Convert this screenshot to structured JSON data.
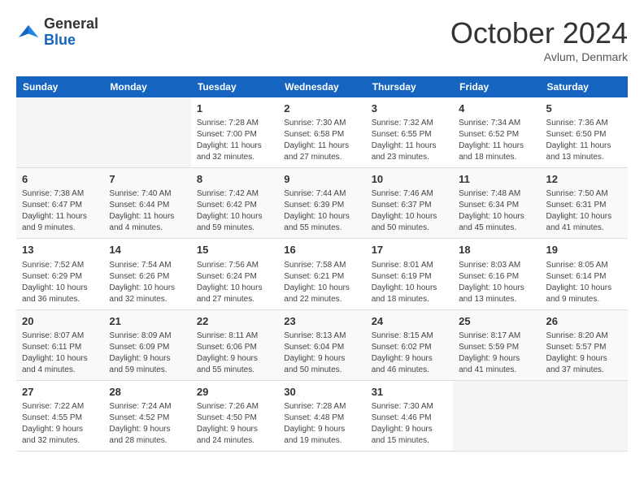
{
  "header": {
    "logo_line1": "General",
    "logo_line2": "Blue",
    "month_title": "October 2024",
    "location": "Avlum, Denmark"
  },
  "weekdays": [
    "Sunday",
    "Monday",
    "Tuesday",
    "Wednesday",
    "Thursday",
    "Friday",
    "Saturday"
  ],
  "weeks": [
    [
      {
        "day": "",
        "info": ""
      },
      {
        "day": "",
        "info": ""
      },
      {
        "day": "1",
        "info": "Sunrise: 7:28 AM\nSunset: 7:00 PM\nDaylight: 11 hours and 32 minutes."
      },
      {
        "day": "2",
        "info": "Sunrise: 7:30 AM\nSunset: 6:58 PM\nDaylight: 11 hours and 27 minutes."
      },
      {
        "day": "3",
        "info": "Sunrise: 7:32 AM\nSunset: 6:55 PM\nDaylight: 11 hours and 23 minutes."
      },
      {
        "day": "4",
        "info": "Sunrise: 7:34 AM\nSunset: 6:52 PM\nDaylight: 11 hours and 18 minutes."
      },
      {
        "day": "5",
        "info": "Sunrise: 7:36 AM\nSunset: 6:50 PM\nDaylight: 11 hours and 13 minutes."
      }
    ],
    [
      {
        "day": "6",
        "info": "Sunrise: 7:38 AM\nSunset: 6:47 PM\nDaylight: 11 hours and 9 minutes."
      },
      {
        "day": "7",
        "info": "Sunrise: 7:40 AM\nSunset: 6:44 PM\nDaylight: 11 hours and 4 minutes."
      },
      {
        "day": "8",
        "info": "Sunrise: 7:42 AM\nSunset: 6:42 PM\nDaylight: 10 hours and 59 minutes."
      },
      {
        "day": "9",
        "info": "Sunrise: 7:44 AM\nSunset: 6:39 PM\nDaylight: 10 hours and 55 minutes."
      },
      {
        "day": "10",
        "info": "Sunrise: 7:46 AM\nSunset: 6:37 PM\nDaylight: 10 hours and 50 minutes."
      },
      {
        "day": "11",
        "info": "Sunrise: 7:48 AM\nSunset: 6:34 PM\nDaylight: 10 hours and 45 minutes."
      },
      {
        "day": "12",
        "info": "Sunrise: 7:50 AM\nSunset: 6:31 PM\nDaylight: 10 hours and 41 minutes."
      }
    ],
    [
      {
        "day": "13",
        "info": "Sunrise: 7:52 AM\nSunset: 6:29 PM\nDaylight: 10 hours and 36 minutes."
      },
      {
        "day": "14",
        "info": "Sunrise: 7:54 AM\nSunset: 6:26 PM\nDaylight: 10 hours and 32 minutes."
      },
      {
        "day": "15",
        "info": "Sunrise: 7:56 AM\nSunset: 6:24 PM\nDaylight: 10 hours and 27 minutes."
      },
      {
        "day": "16",
        "info": "Sunrise: 7:58 AM\nSunset: 6:21 PM\nDaylight: 10 hours and 22 minutes."
      },
      {
        "day": "17",
        "info": "Sunrise: 8:01 AM\nSunset: 6:19 PM\nDaylight: 10 hours and 18 minutes."
      },
      {
        "day": "18",
        "info": "Sunrise: 8:03 AM\nSunset: 6:16 PM\nDaylight: 10 hours and 13 minutes."
      },
      {
        "day": "19",
        "info": "Sunrise: 8:05 AM\nSunset: 6:14 PM\nDaylight: 10 hours and 9 minutes."
      }
    ],
    [
      {
        "day": "20",
        "info": "Sunrise: 8:07 AM\nSunset: 6:11 PM\nDaylight: 10 hours and 4 minutes."
      },
      {
        "day": "21",
        "info": "Sunrise: 8:09 AM\nSunset: 6:09 PM\nDaylight: 9 hours and 59 minutes."
      },
      {
        "day": "22",
        "info": "Sunrise: 8:11 AM\nSunset: 6:06 PM\nDaylight: 9 hours and 55 minutes."
      },
      {
        "day": "23",
        "info": "Sunrise: 8:13 AM\nSunset: 6:04 PM\nDaylight: 9 hours and 50 minutes."
      },
      {
        "day": "24",
        "info": "Sunrise: 8:15 AM\nSunset: 6:02 PM\nDaylight: 9 hours and 46 minutes."
      },
      {
        "day": "25",
        "info": "Sunrise: 8:17 AM\nSunset: 5:59 PM\nDaylight: 9 hours and 41 minutes."
      },
      {
        "day": "26",
        "info": "Sunrise: 8:20 AM\nSunset: 5:57 PM\nDaylight: 9 hours and 37 minutes."
      }
    ],
    [
      {
        "day": "27",
        "info": "Sunrise: 7:22 AM\nSunset: 4:55 PM\nDaylight: 9 hours and 32 minutes."
      },
      {
        "day": "28",
        "info": "Sunrise: 7:24 AM\nSunset: 4:52 PM\nDaylight: 9 hours and 28 minutes."
      },
      {
        "day": "29",
        "info": "Sunrise: 7:26 AM\nSunset: 4:50 PM\nDaylight: 9 hours and 24 minutes."
      },
      {
        "day": "30",
        "info": "Sunrise: 7:28 AM\nSunset: 4:48 PM\nDaylight: 9 hours and 19 minutes."
      },
      {
        "day": "31",
        "info": "Sunrise: 7:30 AM\nSunset: 4:46 PM\nDaylight: 9 hours and 15 minutes."
      },
      {
        "day": "",
        "info": ""
      },
      {
        "day": "",
        "info": ""
      }
    ]
  ]
}
